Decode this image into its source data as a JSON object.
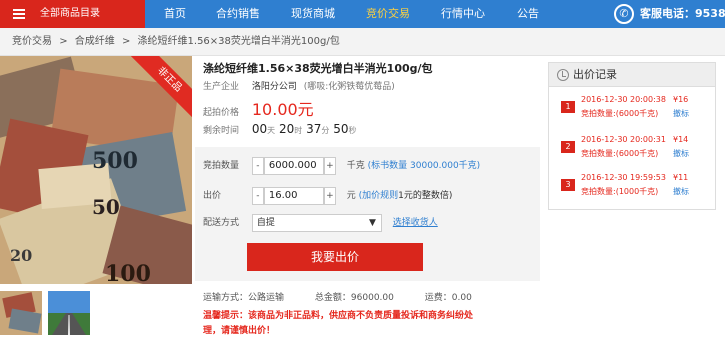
{
  "nav": {
    "category": "全部商品目录",
    "items": [
      "首页",
      "合约销售",
      "现货商城",
      "竞价交易",
      "行情中心",
      "公告"
    ],
    "active_index": 3,
    "hotline": "客服电话：95388"
  },
  "breadcrumb": [
    "竞价交易",
    ">",
    "合成纤维",
    ">",
    "涤纶短纤维1.56×38荧光增白半消光100g/包"
  ],
  "product": {
    "ribbon": "非正品",
    "title": "涤纶短纤维1.56×38荧光增白半消光100g/包",
    "company_label": "生产企业",
    "company": "洛阳分公司",
    "company_note": "(哪吸:化粥铁莓优莓品)",
    "start_price_label": "起拍价格",
    "start_price": "10.00元",
    "countdown_label": "剩余时间",
    "countdown": {
      "d": "00",
      "d_unit": "天",
      "h": "20",
      "h_unit": "时",
      "m": "37",
      "m_unit": "分",
      "s": "50",
      "s_unit": "秒"
    }
  },
  "form": {
    "qty_label": "竞拍数量",
    "qty_value": "6000.000",
    "qty_unit": "千克",
    "qty_link": "(标书数量 30000.000千克)",
    "bid_label": "出价",
    "bid_value": "16.00",
    "bid_unit": "元",
    "bid_rule_link": "(加价规则",
    "bid_rule_text": "1元的整数倍)",
    "delivery_label": "配送方式",
    "delivery_value": "自提",
    "receiver_link": "选择收货人",
    "minus": "-",
    "plus": "+",
    "arrow": "▼",
    "submit": "我要出价"
  },
  "summary": {
    "transport_label": "运输方式：",
    "transport": "公路运输",
    "total_label": "总金额：",
    "total": "96000.00",
    "freight_label": "运费：",
    "freight": "0.00"
  },
  "warning": "温馨提示：该商品为非正品料，供应商不负责质量投诉和商务纠纷处理，请谨慎出价！",
  "records": {
    "title": "出价记录",
    "items": [
      {
        "num": "1",
        "time": "2016-12-30 20:00:38",
        "price": "¥16",
        "qty": "竞拍数量:(6000千克)",
        "action": "撤标"
      },
      {
        "num": "2",
        "time": "2016-12-30 20:00:31",
        "price": "¥14",
        "qty": "竞拍数量:(6000千克)",
        "action": "撤标"
      },
      {
        "num": "3",
        "time": "2016-12-30 19:59:53",
        "price": "¥11",
        "qty": "竞拍数量:(1000千克)",
        "action": "撤标"
      }
    ]
  }
}
